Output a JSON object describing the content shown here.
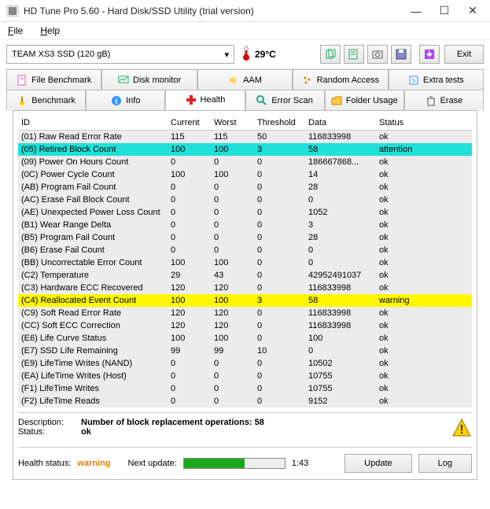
{
  "window": {
    "title": "HD Tune Pro 5.60 - Hard Disk/SSD Utility (trial version)"
  },
  "menu": {
    "file": "File",
    "help": "Help"
  },
  "toolbar": {
    "drive": "TEAM XS3 SSD (120 gB)",
    "temperature": "29°C",
    "exit": "Exit"
  },
  "tabs_row1": {
    "file_benchmark": "File Benchmark",
    "disk_monitor": "Disk monitor",
    "aam": "AAM",
    "random_access": "Random Access",
    "extra_tests": "Extra tests"
  },
  "tabs_row2": {
    "benchmark": "Benchmark",
    "info": "Info",
    "health": "Health",
    "error_scan": "Error Scan",
    "folder_usage": "Folder Usage",
    "erase": "Erase"
  },
  "table": {
    "headers": {
      "id": "ID",
      "current": "Current",
      "worst": "Worst",
      "threshold": "Threshold",
      "data": "Data",
      "status": "Status"
    },
    "rows": [
      {
        "id": "(01) Raw Read Error Rate",
        "current": "115",
        "worst": "115",
        "threshold": "50",
        "data": "116833998",
        "status": "ok",
        "hl": ""
      },
      {
        "id": "(05) Retired Block Count",
        "current": "100",
        "worst": "100",
        "threshold": "3",
        "data": "58",
        "status": "attention",
        "hl": "cyan"
      },
      {
        "id": "(09) Power On Hours Count",
        "current": "0",
        "worst": "0",
        "threshold": "0",
        "data": "186667868...",
        "status": "ok",
        "hl": ""
      },
      {
        "id": "(0C) Power Cycle Count",
        "current": "100",
        "worst": "100",
        "threshold": "0",
        "data": "14",
        "status": "ok",
        "hl": ""
      },
      {
        "id": "(AB) Program Fail Count",
        "current": "0",
        "worst": "0",
        "threshold": "0",
        "data": "28",
        "status": "ok",
        "hl": ""
      },
      {
        "id": "(AC) Erase Fail Block Count",
        "current": "0",
        "worst": "0",
        "threshold": "0",
        "data": "0",
        "status": "ok",
        "hl": ""
      },
      {
        "id": "(AE) Unexpected Power Loss Count",
        "current": "0",
        "worst": "0",
        "threshold": "0",
        "data": "1052",
        "status": "ok",
        "hl": ""
      },
      {
        "id": "(B1) Wear Range Delta",
        "current": "0",
        "worst": "0",
        "threshold": "0",
        "data": "3",
        "status": "ok",
        "hl": ""
      },
      {
        "id": "(B5) Program Fail Count",
        "current": "0",
        "worst": "0",
        "threshold": "0",
        "data": "28",
        "status": "ok",
        "hl": ""
      },
      {
        "id": "(B6) Erase Fail Count",
        "current": "0",
        "worst": "0",
        "threshold": "0",
        "data": "0",
        "status": "ok",
        "hl": ""
      },
      {
        "id": "(BB) Uncorrectable Error Count",
        "current": "100",
        "worst": "100",
        "threshold": "0",
        "data": "0",
        "status": "ok",
        "hl": ""
      },
      {
        "id": "(C2) Temperature",
        "current": "29",
        "worst": "43",
        "threshold": "0",
        "data": "42952491037",
        "status": "ok",
        "hl": ""
      },
      {
        "id": "(C3) Hardware ECC Recovered",
        "current": "120",
        "worst": "120",
        "threshold": "0",
        "data": "116833998",
        "status": "ok",
        "hl": ""
      },
      {
        "id": "(C4) Reallocated Event Count",
        "current": "100",
        "worst": "100",
        "threshold": "3",
        "data": "58",
        "status": "warning",
        "hl": "yellow"
      },
      {
        "id": "(C9) Soft Read Error Rate",
        "current": "120",
        "worst": "120",
        "threshold": "0",
        "data": "116833998",
        "status": "ok",
        "hl": ""
      },
      {
        "id": "(CC) Soft ECC Correction",
        "current": "120",
        "worst": "120",
        "threshold": "0",
        "data": "116833998",
        "status": "ok",
        "hl": ""
      },
      {
        "id": "(E6) Life Curve Status",
        "current": "100",
        "worst": "100",
        "threshold": "0",
        "data": "100",
        "status": "ok",
        "hl": ""
      },
      {
        "id": "(E7) SSD Life Remaining",
        "current": "99",
        "worst": "99",
        "threshold": "10",
        "data": "0",
        "status": "ok",
        "hl": ""
      },
      {
        "id": "(E9) LifeTime Writes (NAND)",
        "current": "0",
        "worst": "0",
        "threshold": "0",
        "data": "10502",
        "status": "ok",
        "hl": ""
      },
      {
        "id": "(EA) LifeTime Writes (Host)",
        "current": "0",
        "worst": "0",
        "threshold": "0",
        "data": "10755",
        "status": "ok",
        "hl": ""
      },
      {
        "id": "(F1) LifeTime Writes",
        "current": "0",
        "worst": "0",
        "threshold": "0",
        "data": "10755",
        "status": "ok",
        "hl": ""
      },
      {
        "id": "(F2) LifeTime Reads",
        "current": "0",
        "worst": "0",
        "threshold": "0",
        "data": "9152",
        "status": "ok",
        "hl": ""
      }
    ]
  },
  "description": {
    "desc_label": "Description:",
    "desc_value": "Number of block replacement operations: 58",
    "status_label": "Status:",
    "status_value": "ok"
  },
  "footer": {
    "health_label": "Health status:",
    "health_value": "warning",
    "next_update_label": "Next update:",
    "next_update_time": "1:43",
    "update_btn": "Update",
    "log_btn": "Log"
  }
}
